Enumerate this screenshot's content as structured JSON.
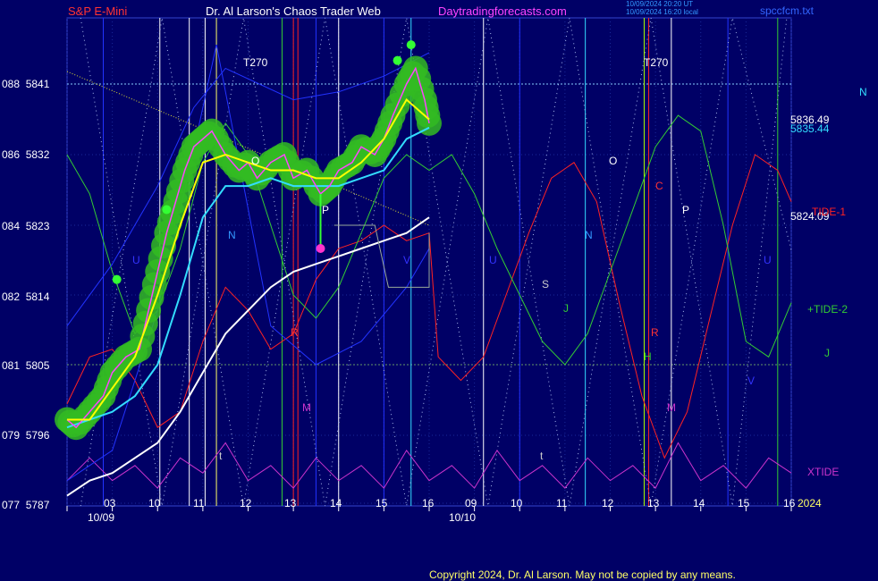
{
  "header": {
    "left": "S&P E-Mini",
    "center": "Dr. Al Larson's Chaos Trader Web",
    "site": "Daytradingforecasts.com",
    "stamp1": "10/09/2024 20:20 UT",
    "stamp2": "10/09/2024 16:20 local",
    "file": "spccfcm.txt"
  },
  "colors": {
    "background": "#000066",
    "price": "#ff44ff",
    "glow": "#22ff22",
    "ema_fast": "#ffff00",
    "ema_mid": "#33ddff",
    "ema_slow": "#ffffff",
    "tide1": "#ff2222",
    "tide2": "#33cc33",
    "xtide": "#cc33cc",
    "lines_blue": "#2233ff",
    "copyright": "#ffff66",
    "title_red": "#ff3333",
    "site_magenta": "#ff44ff"
  },
  "chart_data": {
    "type": "line",
    "title": "S&P E-Mini",
    "y_axis": {
      "ticks": [
        {
          "code": "077",
          "price": 5787
        },
        {
          "code": "079",
          "price": 5796
        },
        {
          "code": "081",
          "price": 5805
        },
        {
          "code": "082",
          "price": 5814
        },
        {
          "code": "084",
          "price": 5823
        },
        {
          "code": "086",
          "price": 5832
        },
        {
          "code": "088",
          "price": 5841
        }
      ],
      "range": [
        5787,
        5846
      ]
    },
    "x_axis": {
      "hour_ticks": [
        "03",
        "10",
        "11",
        "12",
        "13",
        "14",
        "15",
        "16",
        "09",
        "10",
        "11",
        "12",
        "13",
        "14",
        "15",
        "16"
      ],
      "date_labels": [
        "10/09",
        "10/10"
      ],
      "year": "2024"
    },
    "price_labels": {
      "ema_fast": "5836.49",
      "ema_mid": "5835.44",
      "tide1": "5824.09"
    },
    "marker_labels": [
      "T270",
      "T270",
      "O",
      "P",
      "N",
      "U",
      "R",
      "M",
      "t",
      "O",
      "P",
      "N",
      "U",
      "V",
      "S",
      "J",
      "C",
      "R",
      "H",
      "M",
      "t",
      "V"
    ],
    "right_labels": {
      "tide1": "TIDE-1",
      "tide2": "+TIDE-2",
      "xtide": "XTIDE",
      "n": "N",
      "j": "J",
      "u": "U"
    },
    "series": [
      {
        "name": "S&P E-Mini",
        "values": [
          [
            0,
            5798
          ],
          [
            0.2,
            5797
          ],
          [
            0.5,
            5799
          ],
          [
            0.8,
            5801
          ],
          [
            1.0,
            5804
          ],
          [
            1.3,
            5806
          ],
          [
            1.6,
            5807
          ],
          [
            1.8,
            5812
          ],
          [
            2.0,
            5817
          ],
          [
            2.2,
            5822
          ],
          [
            2.4,
            5826
          ],
          [
            2.6,
            5830
          ],
          [
            2.8,
            5833
          ],
          [
            3.0,
            5834
          ],
          [
            3.2,
            5835
          ],
          [
            3.5,
            5832
          ],
          [
            3.8,
            5830
          ],
          [
            4.0,
            5831
          ],
          [
            4.2,
            5829
          ],
          [
            4.5,
            5831
          ],
          [
            4.8,
            5832
          ],
          [
            5.0,
            5829
          ],
          [
            5.3,
            5830
          ],
          [
            5.6,
            5827
          ],
          [
            5.8,
            5828
          ],
          [
            6.0,
            5830
          ],
          [
            6.3,
            5831
          ],
          [
            6.5,
            5833
          ],
          [
            6.8,
            5832
          ],
          [
            7.0,
            5834
          ],
          [
            7.2,
            5837
          ],
          [
            7.5,
            5841
          ],
          [
            7.7,
            5843
          ],
          [
            7.9,
            5839
          ],
          [
            8.0,
            5836
          ]
        ]
      },
      {
        "name": "",
        "values": [
          [
            0,
            5798
          ],
          [
            0.5,
            5798
          ],
          [
            1.0,
            5802
          ],
          [
            1.5,
            5806
          ],
          [
            2.0,
            5814
          ],
          [
            2.5,
            5823
          ],
          [
            3.0,
            5831
          ],
          [
            3.5,
            5832
          ],
          [
            4.0,
            5831
          ],
          [
            4.5,
            5830
          ],
          [
            5.0,
            5830
          ],
          [
            5.5,
            5829
          ],
          [
            6.0,
            5829
          ],
          [
            6.5,
            5831
          ],
          [
            7.0,
            5834
          ],
          [
            7.5,
            5839
          ],
          [
            8.0,
            5836.49
          ]
        ]
      },
      {
        "name": "",
        "values": [
          [
            0,
            5797
          ],
          [
            0.5,
            5798
          ],
          [
            1.0,
            5799
          ],
          [
            1.5,
            5801
          ],
          [
            2.0,
            5805
          ],
          [
            2.5,
            5814
          ],
          [
            3.0,
            5824
          ],
          [
            3.5,
            5828
          ],
          [
            4.0,
            5828
          ],
          [
            4.5,
            5829
          ],
          [
            5.0,
            5828
          ],
          [
            5.5,
            5828
          ],
          [
            6.0,
            5828
          ],
          [
            6.5,
            5829
          ],
          [
            7.0,
            5830
          ],
          [
            7.5,
            5834
          ],
          [
            8.0,
            5835.44
          ]
        ]
      },
      {
        "name": "",
        "values": [
          [
            0,
            5788
          ],
          [
            0.5,
            5790
          ],
          [
            1.0,
            5791
          ],
          [
            1.5,
            5793
          ],
          [
            2.0,
            5795
          ],
          [
            2.5,
            5799
          ],
          [
            3.0,
            5804
          ],
          [
            3.5,
            5809
          ],
          [
            4.0,
            5812
          ],
          [
            4.5,
            5815
          ],
          [
            5.0,
            5817
          ],
          [
            5.5,
            5818
          ],
          [
            6.0,
            5819
          ],
          [
            6.5,
            5820
          ],
          [
            7.0,
            5821
          ],
          [
            7.5,
            5822
          ],
          [
            8.0,
            5824
          ]
        ]
      },
      {
        "name": "TIDE-1",
        "values": [
          [
            0,
            5800
          ],
          [
            0.5,
            5806
          ],
          [
            1.0,
            5807
          ],
          [
            1.5,
            5803
          ],
          [
            2.0,
            5797
          ],
          [
            2.5,
            5799
          ],
          [
            3.0,
            5808
          ],
          [
            3.5,
            5815
          ],
          [
            4.0,
            5812
          ],
          [
            4.5,
            5807
          ],
          [
            5.0,
            5809
          ],
          [
            5.5,
            5816
          ],
          [
            6.0,
            5820
          ],
          [
            6.5,
            5821
          ],
          [
            7.0,
            5823
          ],
          [
            7.5,
            5821
          ],
          [
            8.0,
            5822
          ],
          [
            8.2,
            5806
          ],
          [
            8.7,
            5803
          ],
          [
            9.2,
            5806
          ],
          [
            9.7,
            5814
          ],
          [
            10.2,
            5822
          ],
          [
            10.7,
            5829
          ],
          [
            11.2,
            5831
          ],
          [
            11.7,
            5826
          ],
          [
            12.2,
            5813
          ],
          [
            12.7,
            5801
          ],
          [
            13.2,
            5793
          ],
          [
            13.7,
            5799
          ],
          [
            14.2,
            5811
          ],
          [
            14.7,
            5823
          ],
          [
            15.2,
            5832
          ],
          [
            15.7,
            5830
          ],
          [
            16,
            5826
          ]
        ]
      },
      {
        "name": "+TIDE-2",
        "values": [
          [
            0,
            5832
          ],
          [
            0.5,
            5827
          ],
          [
            1.0,
            5817
          ],
          [
            1.5,
            5809
          ],
          [
            2.0,
            5812
          ],
          [
            2.5,
            5820
          ],
          [
            3.0,
            5831
          ],
          [
            3.5,
            5836
          ],
          [
            4.0,
            5832
          ],
          [
            4.5,
            5823
          ],
          [
            5.0,
            5814
          ],
          [
            5.5,
            5811
          ],
          [
            6.0,
            5815
          ],
          [
            6.5,
            5822
          ],
          [
            7.0,
            5829
          ],
          [
            7.5,
            5832
          ],
          [
            8.0,
            5830
          ],
          [
            8.5,
            5832
          ],
          [
            9.0,
            5827
          ],
          [
            9.5,
            5820
          ],
          [
            10.0,
            5814
          ],
          [
            10.5,
            5808
          ],
          [
            11.0,
            5805
          ],
          [
            11.5,
            5809
          ],
          [
            12.0,
            5817
          ],
          [
            12.5,
            5825
          ],
          [
            13.0,
            5833
          ],
          [
            13.5,
            5837
          ],
          [
            14.0,
            5835
          ],
          [
            14.5,
            5823
          ],
          [
            15.0,
            5808
          ],
          [
            15.5,
            5806
          ],
          [
            16,
            5813
          ]
        ]
      },
      {
        "name": "XTIDE",
        "values": [
          [
            0,
            5790
          ],
          [
            0.5,
            5793
          ],
          [
            1.0,
            5790
          ],
          [
            1.5,
            5792
          ],
          [
            2.0,
            5789
          ],
          [
            2.5,
            5793
          ],
          [
            3.0,
            5791
          ],
          [
            3.5,
            5795
          ],
          [
            4.0,
            5790
          ],
          [
            4.5,
            5792
          ],
          [
            5.0,
            5789
          ],
          [
            5.5,
            5793
          ],
          [
            6.0,
            5790
          ],
          [
            6.5,
            5792
          ],
          [
            7.0,
            5789
          ],
          [
            7.5,
            5794
          ],
          [
            8.0,
            5790
          ],
          [
            8.5,
            5792
          ],
          [
            9.0,
            5789
          ],
          [
            9.5,
            5794
          ],
          [
            10.0,
            5790
          ],
          [
            10.5,
            5792
          ],
          [
            11.0,
            5789
          ],
          [
            11.5,
            5793
          ],
          [
            12.0,
            5790
          ],
          [
            12.5,
            5792
          ],
          [
            13.0,
            5789
          ],
          [
            13.5,
            5795
          ],
          [
            14.0,
            5790
          ],
          [
            14.5,
            5792
          ],
          [
            15.0,
            5789
          ],
          [
            15.5,
            5793
          ],
          [
            16,
            5791
          ]
        ]
      }
    ],
    "reference_lines": [
      5841,
      5805
    ]
  },
  "copyright": "Copyright 2024, Dr. Al Larson. May not be copied by any means."
}
